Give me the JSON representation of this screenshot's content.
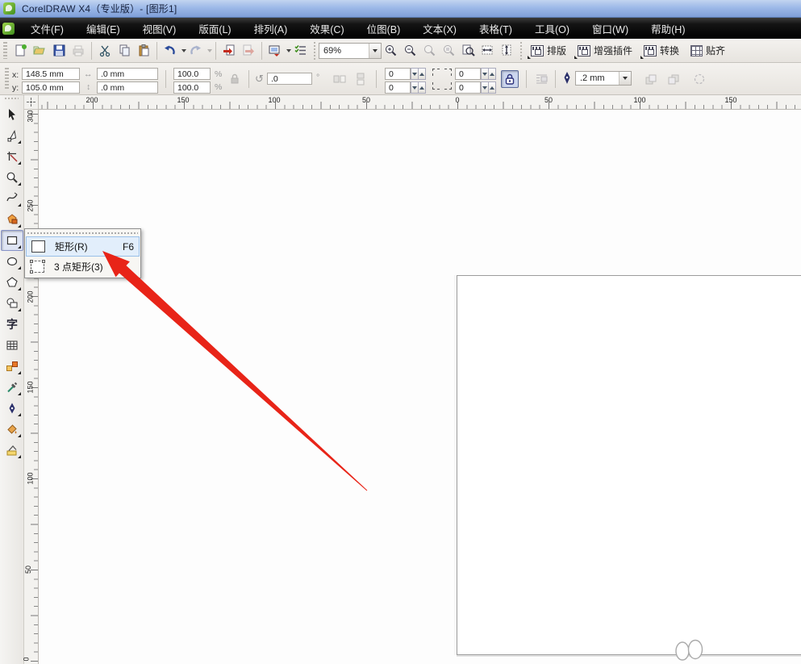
{
  "window": {
    "title": "CorelDRAW X4（专业版）- [图形1]"
  },
  "menubar": {
    "items": [
      "文件(F)",
      "编辑(E)",
      "视图(V)",
      "版面(L)",
      "排列(A)",
      "效果(C)",
      "位图(B)",
      "文本(X)",
      "表格(T)",
      "工具(O)",
      "窗口(W)",
      "帮助(H)"
    ]
  },
  "toolbar": {
    "zoom_level": "69%",
    "button_names": [
      "new",
      "open",
      "save",
      "print",
      "cut",
      "copy",
      "paste",
      "undo",
      "redo",
      "import",
      "export",
      "application-launcher",
      "options-check",
      "zoom-in",
      "zoom-out",
      "zoom-actual",
      "zoom-to-selection",
      "zoom-to-page",
      "zoom-to-width",
      "zoom-to-height"
    ],
    "plugin_buttons": [
      "排版",
      "增强插件",
      "转换",
      "贴齐"
    ]
  },
  "property_bar": {
    "x_label": "x:",
    "x_value": "148.5 mm",
    "y_label": "y:",
    "y_value": "105.0 mm",
    "width_value": ".0 mm",
    "height_value": ".0 mm",
    "scale_h": "100.0",
    "scale_v": "100.0",
    "percent": "%",
    "rotation_value": ".0",
    "degree": "°",
    "corner_left_top": "0",
    "corner_left_bottom": "0",
    "corner_right_top": "0",
    "corner_right_bottom": "0",
    "outline_width": ".2 mm"
  },
  "rulers": {
    "top_labels": [
      "200",
      "150",
      "100",
      "50",
      "0",
      "50",
      "100",
      "150"
    ],
    "left_labels": [
      "300",
      "250",
      "200",
      "150",
      "100",
      "50",
      "0"
    ]
  },
  "toolbox": {
    "tools": [
      "pick-tool",
      "shape-tool",
      "crop-tool",
      "zoom-tool",
      "freehand-tool",
      "smart-fill-tool",
      "rectangle-tool",
      "ellipse-tool",
      "polygon-tool",
      "basic-shapes-tool",
      "text-tool",
      "table-tool",
      "interactive-blend-tool",
      "eyedropper-tool",
      "outline-tool",
      "fill-tool",
      "interactive-fill-tool"
    ],
    "active_tool": "rectangle-tool",
    "text_tool_glyph": "字"
  },
  "flyout": {
    "items": [
      {
        "label": "矩形(R)",
        "shortcut": "F6"
      },
      {
        "label": "3 点矩形(3)",
        "shortcut": ""
      }
    ]
  },
  "colors": {
    "arrow": "#e82418",
    "menu_highlight": "#e2eefb",
    "titlebar": "#9db9e8"
  }
}
